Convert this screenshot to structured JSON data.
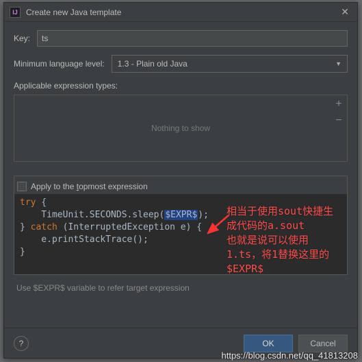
{
  "titlebar": {
    "title": "Create new Java template"
  },
  "key": {
    "label": "Key:",
    "value": "ts"
  },
  "level": {
    "label": "Minimum language level:",
    "value": "1.3 - Plain old Java"
  },
  "types": {
    "label": "Applicable expression types:",
    "placeholder": "Nothing to show"
  },
  "checkbox": {
    "label": "Apply to the topmost expression"
  },
  "code": {
    "line1_kw": "try",
    "line1_rest": " {",
    "line2_a": "    TimeUnit.SECONDS.sleep(",
    "line2_var": "$EXPR$",
    "line2_b": ");",
    "line3_a": "} ",
    "line3_kw": "catch",
    "line3_b": " (InterruptedException e) {",
    "line4": "    e.printStackTrace();",
    "line5": "}"
  },
  "hint": "Use $EXPR$ variable to refer target expression",
  "buttons": {
    "ok": "OK",
    "cancel": "Cancel"
  },
  "annotation": {
    "l1": "相当于使用sout快捷生",
    "l2": "成代码的a.sout",
    "l3": "也就是说可以使用",
    "l4": "1.ts，将1替换这里的",
    "l5": "$EXPR$"
  },
  "watermark": "https://blog.csdn.net/qq_41813208"
}
